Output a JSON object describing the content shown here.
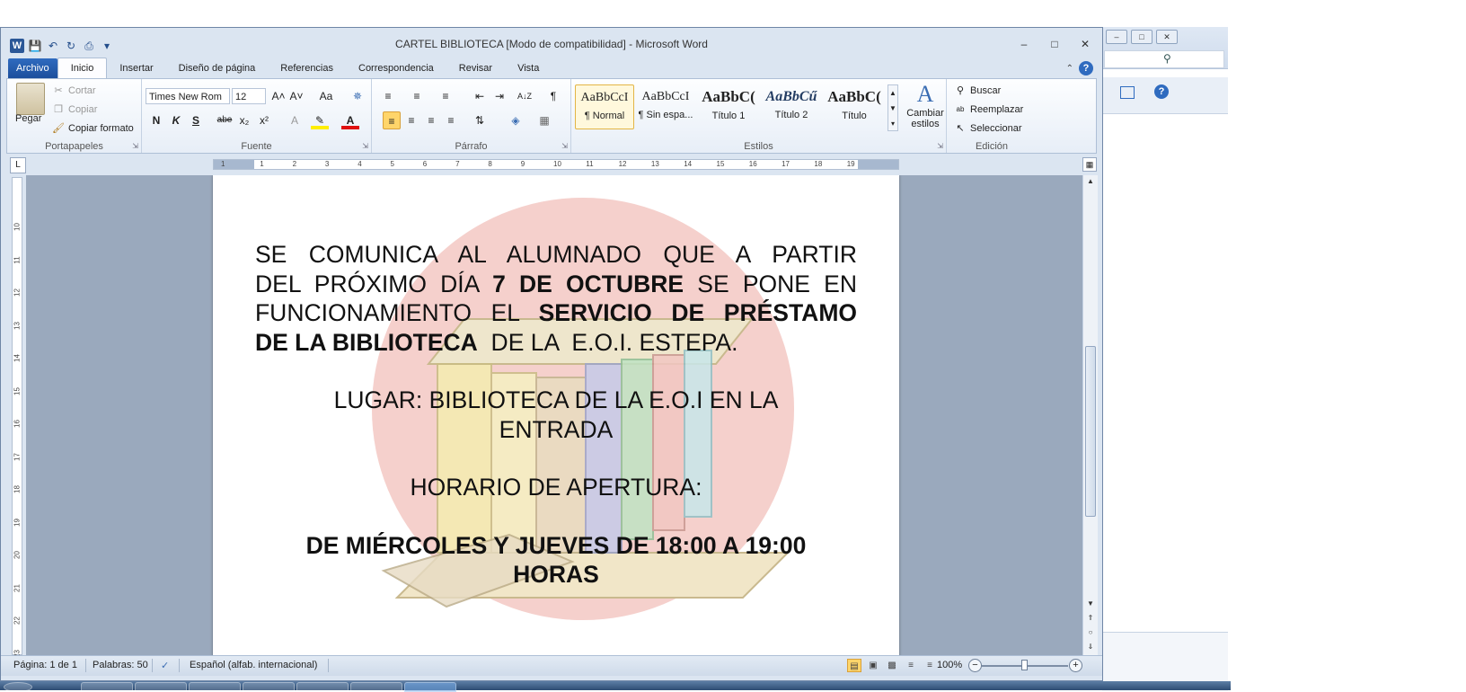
{
  "window": {
    "title": "CARTEL BIBLIOTECA [Modo de compatibilidad]  -  Microsoft Word",
    "min": "–",
    "max": "□",
    "close": "✕"
  },
  "qat": {
    "logo": "W",
    "save": "💾",
    "undo": "↶",
    "redo": "↻",
    "print": "⎙",
    "more": "▾"
  },
  "tabs": [
    {
      "label": "Archivo"
    },
    {
      "label": "Inicio"
    },
    {
      "label": "Insertar"
    },
    {
      "label": "Diseño de página"
    },
    {
      "label": "Referencias"
    },
    {
      "label": "Correspondencia"
    },
    {
      "label": "Revisar"
    },
    {
      "label": "Vista"
    }
  ],
  "ribbon": {
    "portapapeles": {
      "label": "Portapapeles",
      "paste": "Pegar",
      "cut": "Cortar",
      "copy": "Copiar",
      "format_painter": "Copiar formato"
    },
    "fuente": {
      "label": "Fuente",
      "font_name": "Times New Rom",
      "font_size": "12",
      "bold": "N",
      "italic": "K",
      "underline": "S",
      "strike": "abe",
      "sub": "x₂",
      "sup": "x²",
      "grow": "A˄",
      "shrink": "A˅",
      "case": "Aa"
    },
    "parrafo": {
      "label": "Párrafo",
      "pilcrow": "¶",
      "sort": "A↓Z"
    },
    "estilos": {
      "label": "Estilos",
      "items": [
        {
          "preview": "AaBbCcI",
          "name": "¶ Normal"
        },
        {
          "preview": "AaBbCcI",
          "name": "¶ Sin espa..."
        },
        {
          "preview": "AaBbC(",
          "name": "Título 1"
        },
        {
          "preview": "AaBbCű",
          "name": "Título 2"
        },
        {
          "preview": "AaBbC(",
          "name": "Título"
        }
      ],
      "change": "Cambiar estilos"
    },
    "edicion": {
      "label": "Edición",
      "find": "Buscar",
      "replace": "Reemplazar",
      "select": "Seleccionar"
    }
  },
  "ruler": {
    "tab_selector": "L",
    "h_numbers": [
      "1",
      "1",
      "2",
      "3",
      "4",
      "5",
      "6",
      "7",
      "8",
      "9",
      "10",
      "11",
      "12",
      "13",
      "14",
      "15",
      "16",
      "17",
      "18",
      "19"
    ],
    "v_numbers": [
      "10",
      "11",
      "12",
      "13",
      "14",
      "15",
      "16",
      "17",
      "18",
      "19",
      "20",
      "21",
      "22",
      "23"
    ]
  },
  "document": {
    "p1_line1": "SE COMUNICA AL ALUMNADO QUE A PARTIR",
    "p1_line2a": "DEL PRÓXIMO DÍA ",
    "p1_line2b": "7 DE OCTUBRE",
    "p1_line2c": " SE PONE EN",
    "p1_line3a": "FUNCIONAMIENTO EL ",
    "p1_line3b": "SERVICIO DE PRÉSTAMO",
    "p1_line4a": "DE LA BIBLIOTECA",
    "p1_line4b": "  DE LA  E.O.I. ESTEPA.",
    "lugar": "LUGAR: BIBLIOTECA DE LA E.O.I EN LA ENTRADA",
    "horario_title": "HORARIO DE APERTURA:",
    "horario": "DE MIÉRCOLES Y JUEVES DE 18:00 A 19:00 HORAS"
  },
  "status": {
    "page": "Página: 1 de 1",
    "words": "Palabras: 50",
    "language": "Español (alfab. internacional)",
    "zoom": "100%",
    "zoom_value": 100
  }
}
